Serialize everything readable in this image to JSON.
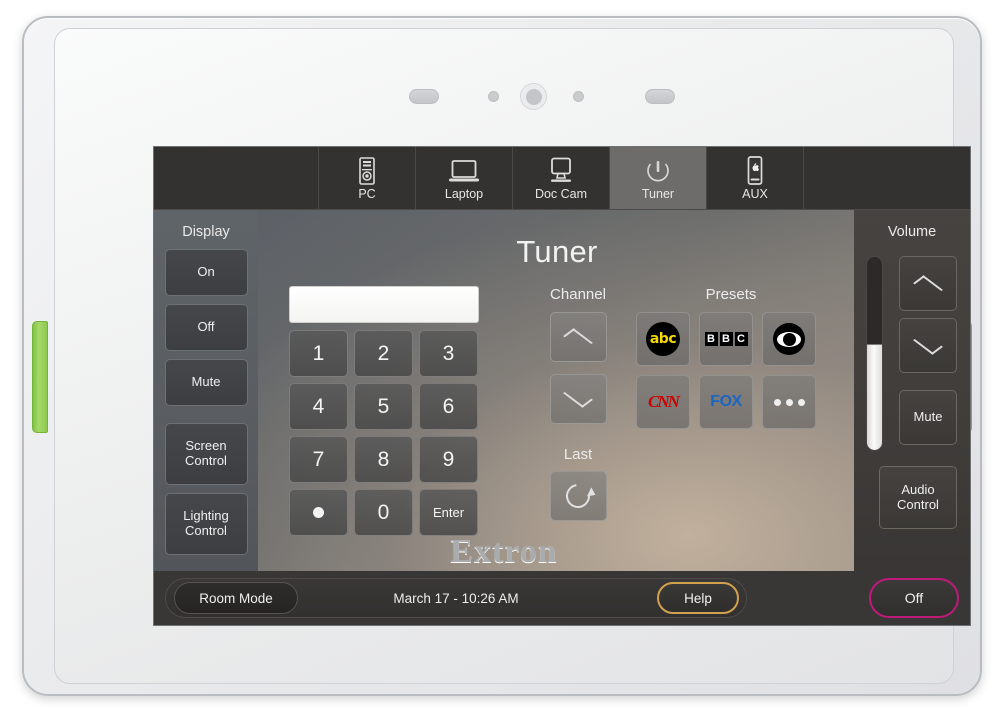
{
  "device": {
    "brand": "Extron",
    "bezel_controls": [
      "pill-button-left",
      "dot-indicator-left",
      "home-button",
      "dot-indicator-right",
      "pill-button-right"
    ]
  },
  "source_tabs": [
    {
      "label": "PC",
      "icon": "desktop-tower-icon",
      "active": false
    },
    {
      "label": "Laptop",
      "icon": "laptop-icon",
      "active": false
    },
    {
      "label": "Doc Cam",
      "icon": "document-camera-icon",
      "active": false
    },
    {
      "label": "Tuner",
      "icon": "power-standby-icon",
      "active": true
    },
    {
      "label": "AUX",
      "icon": "mobile-phone-icon",
      "active": false
    }
  ],
  "display_sidebar": {
    "title": "Display",
    "buttons": [
      {
        "label": "On"
      },
      {
        "label": "Off"
      },
      {
        "label": "Mute"
      },
      {
        "label": "Screen\nControl",
        "line1": "Screen",
        "line2": "Control"
      },
      {
        "label": "Lighting\nControl",
        "line1": "Lighting",
        "line2": "Control"
      }
    ]
  },
  "volume_sidebar": {
    "title": "Volume",
    "slider": {
      "name": "volume-slider",
      "fill_percent": 55
    },
    "up_icon": "chevron-up-icon",
    "down_icon": "chevron-down-icon",
    "mute_label": "Mute",
    "audio_control_line1": "Audio",
    "audio_control_line2": "Control"
  },
  "tuner_panel": {
    "title": "Tuner",
    "keypad": {
      "display_value": "",
      "keys": [
        "1",
        "2",
        "3",
        "4",
        "5",
        "6",
        "7",
        "8",
        "9",
        ".",
        "0",
        "Enter"
      ]
    },
    "channel": {
      "label": "Channel",
      "up_icon": "chevron-up-icon",
      "down_icon": "chevron-down-icon"
    },
    "last": {
      "label": "Last",
      "icon": "refresh-back-icon"
    },
    "presets": {
      "label": "Presets",
      "items": [
        {
          "name": "abc",
          "logo": "abc-logo",
          "color": "#f5d800"
        },
        {
          "name": "BBC",
          "logo": "bbc-logo",
          "color": "#000000"
        },
        {
          "name": "CBS",
          "logo": "cbs-eye-logo",
          "color": "#000000"
        },
        {
          "name": "CNN",
          "logo": "cnn-logo",
          "color": "#cc0000"
        },
        {
          "name": "FOX",
          "logo": "fox-logo",
          "color": "#1a66c2"
        },
        {
          "name": "More",
          "logo": "more-ellipsis-icon",
          "color": "#efefef"
        }
      ]
    }
  },
  "status_bar": {
    "room_mode_label": "Room Mode",
    "datetime": "March 17 - 10:26 AM",
    "help_label": "Help",
    "power_off_label": "Off",
    "help_accent_color": "#d2a14e",
    "power_accent_color": "#c0197a"
  }
}
